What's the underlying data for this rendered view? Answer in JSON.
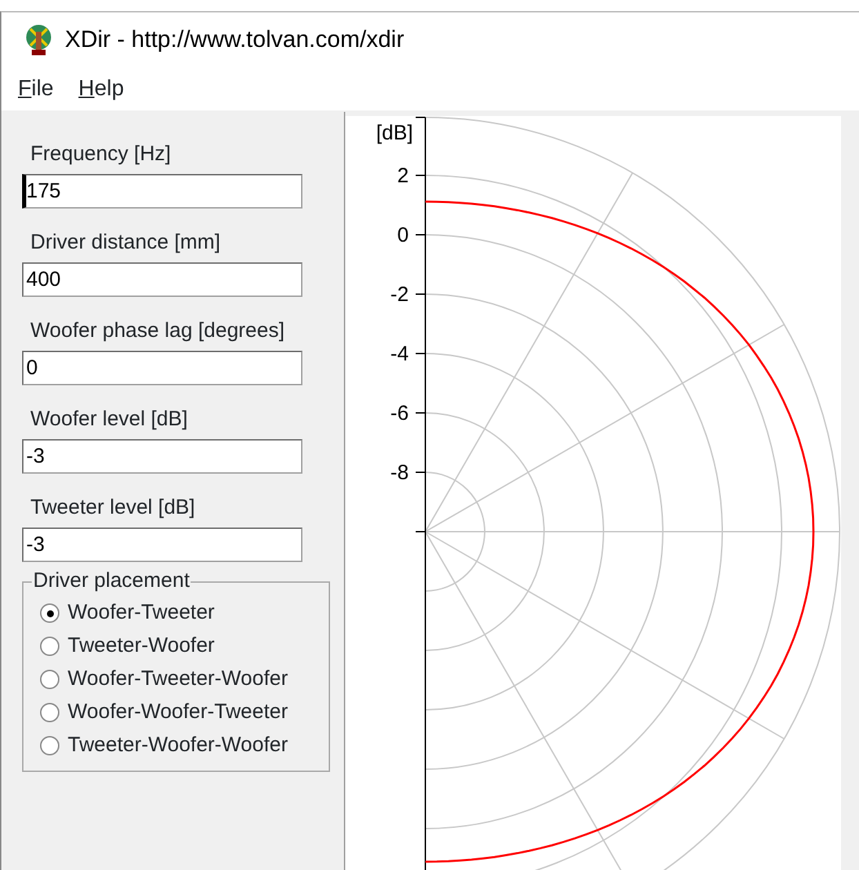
{
  "window": {
    "title": "XDir - http://www.tolvan.com/xdir"
  },
  "menu": [
    {
      "label": "File"
    },
    {
      "label": "Help"
    }
  ],
  "fields": [
    {
      "label": "Frequency [Hz]",
      "value": "175",
      "focused": true
    },
    {
      "label": "Driver distance [mm]",
      "value": "400",
      "focused": false
    },
    {
      "label": "Woofer phase lag [degrees]",
      "value": "0",
      "focused": false
    },
    {
      "label": "Woofer level [dB]",
      "value": "-3",
      "focused": false
    },
    {
      "label": "Tweeter level [dB]",
      "value": "-3",
      "focused": false
    }
  ],
  "driver_placement": {
    "title": "Driver placement",
    "options": [
      {
        "label": "Woofer-Tweeter",
        "selected": true
      },
      {
        "label": "Tweeter-Woofer",
        "selected": false
      },
      {
        "label": "Woofer-Tweeter-Woofer",
        "selected": false
      },
      {
        "label": "Woofer-Woofer-Tweeter",
        "selected": false
      },
      {
        "label": "Tweeter-Woofer-Woofer",
        "selected": false
      }
    ]
  },
  "plot": {
    "unit_label": "[dB]",
    "tick_labels": [
      "2",
      "0",
      "-2",
      "-4",
      "-6",
      "-8"
    ]
  }
}
